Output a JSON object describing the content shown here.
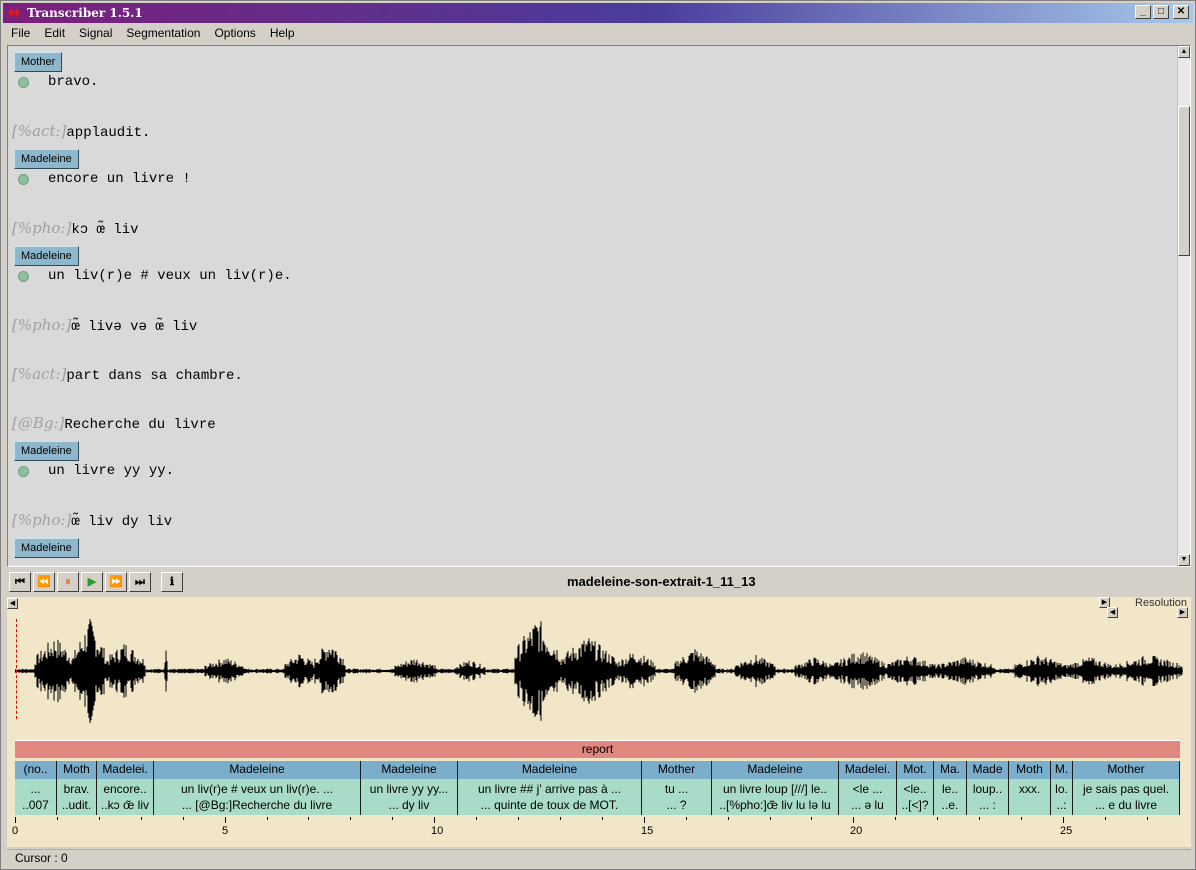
{
  "window": {
    "title": "Transcriber 1.5.1",
    "min": "_",
    "max": "□",
    "close": "✕"
  },
  "menu": [
    "File",
    "Edit",
    "Signal",
    "Segmentation",
    "Options",
    "Help"
  ],
  "transcript": {
    "blocks": [
      {
        "speaker": "Mother",
        "text": "bravo."
      },
      {
        "tag": "[%act:]",
        "text": "applaudit."
      },
      {
        "speaker": "Madeleine",
        "text": "encore un livre !"
      },
      {
        "tag": "[%pho:]",
        "text": "kɔ œ̃ liv"
      },
      {
        "speaker": "Madeleine",
        "text": "un liv(r)e # veux un liv(r)e."
      },
      {
        "tag": "[%pho:]",
        "text": "œ̃ livə və œ̃ liv"
      },
      {
        "tag": "[%act:]",
        "text": "part dans sa chambre."
      },
      {
        "tag": "[@Bg:]",
        "text": "Recherche du livre"
      },
      {
        "speaker": "Madeleine",
        "text": "un livre yy yy."
      },
      {
        "tag": "[%pho:]",
        "text": "œ̃ liv dy liv"
      },
      {
        "speaker": "Madeleine",
        "text": ""
      }
    ]
  },
  "player": {
    "buttons": [
      "⏮",
      "⏪",
      "⏸",
      "▶",
      "⏩",
      "⏭",
      "ℹ"
    ],
    "file": "madeleine-son-extrait-1_11_13"
  },
  "resolution_label": "Resolution",
  "report_label": "report",
  "segments": [
    {
      "speaker": "(no..",
      "l1": "...",
      "l2": "..007"
    },
    {
      "speaker": "Moth",
      "l1": "brav.",
      "l2": "..udit."
    },
    {
      "speaker": "Madelei.",
      "l1": "encore..",
      "l2": "..kɔ œ̃ liv"
    },
    {
      "speaker": "Madeleine",
      "l1": "un liv(r)e # veux un liv(r)e. ...",
      "l2": "... [@Bg:]Recherche du livre"
    },
    {
      "speaker": "Madeleine",
      "l1": "un livre yy yy...",
      "l2": "... dy liv"
    },
    {
      "speaker": "Madeleine",
      "l1": "un livre ## j' arrive pas à ...",
      "l2": "... quinte de toux de MOT."
    },
    {
      "speaker": "Mother",
      "l1": "tu ...",
      "l2": "... ?"
    },
    {
      "speaker": "Madeleine",
      "l1": "un livre loup [///] le..",
      "l2": "..[%pho:]œ̃ liv lu lə lu"
    },
    {
      "speaker": "Madelei.",
      "l1": "<le ...",
      "l2": "... ə lu"
    },
    {
      "speaker": "Mot.",
      "l1": "<le..",
      "l2": "..[<]?"
    },
    {
      "speaker": "Ma.",
      "l1": "le..",
      "l2": "..e."
    },
    {
      "speaker": "Made",
      "l1": "loup..",
      "l2": "... :"
    },
    {
      "speaker": "Moth",
      "l1": "xxx.",
      "l2": ""
    },
    {
      "speaker": "M.",
      "l1": "lo.",
      "l2": "..:"
    },
    {
      "speaker": "Mother",
      "l1": "je sais pas quel.",
      "l2": "... e du livre"
    }
  ],
  "axis": {
    "labels": [
      "0",
      "5",
      "10",
      "15",
      "20",
      "25"
    ]
  },
  "status": {
    "cursor": "Cursor : 0"
  }
}
